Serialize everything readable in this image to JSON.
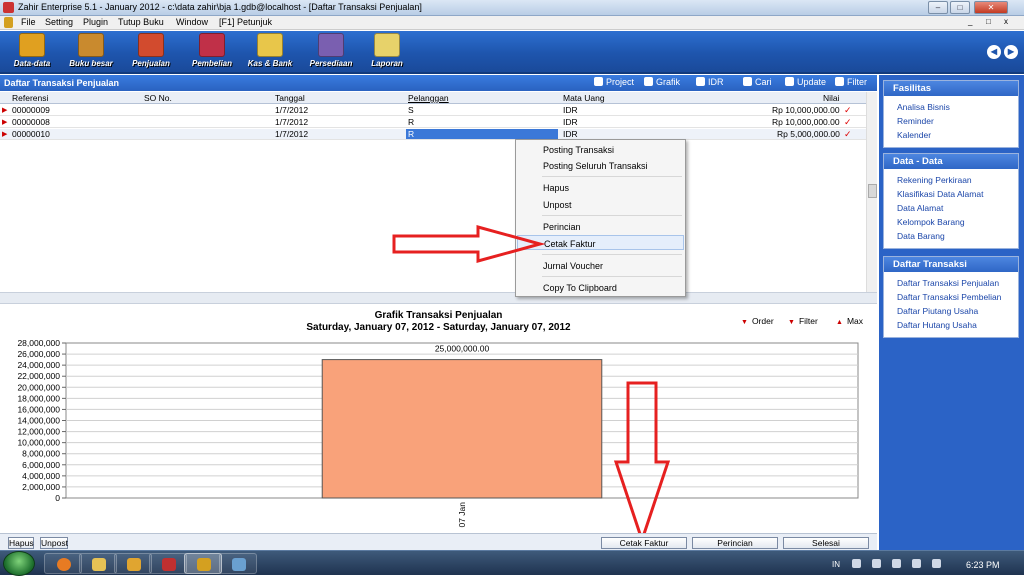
{
  "window": {
    "title": "Zahir Enterprise 5.1 - January 2012 - c:\\data zahir\\bja 1.gdb@localhost - [Daftar Transaksi Penjualan]",
    "controls": [
      "–",
      "□",
      "✕"
    ],
    "child_controls": [
      "_",
      "□",
      "x"
    ]
  },
  "menu": [
    "File",
    "Setting",
    "Plugin",
    "Tutup Buku",
    "Window",
    "[F1] Petunjuk"
  ],
  "toolbar": [
    {
      "label": "Data-data",
      "color": "#e0a020"
    },
    {
      "label": "Buku besar",
      "color": "#c98a2e"
    },
    {
      "label": "Penjualan",
      "color": "#d24b2e"
    },
    {
      "label": "Pembelian",
      "color": "#c03048"
    },
    {
      "label": "Kas & Bank",
      "color": "#e8c64a"
    },
    {
      "label": "Persediaan",
      "color": "#7a5fb0"
    },
    {
      "label": "Laporan",
      "color": "#e7d26a"
    }
  ],
  "nav": {
    "back": "◀",
    "forward": "▶"
  },
  "panel": {
    "title": "Daftar Transaksi Penjualan",
    "actions": [
      {
        "label": "Project",
        "icon": "project-icon"
      },
      {
        "label": "Grafik",
        "icon": "chart-icon"
      },
      {
        "label": "IDR",
        "icon": "currency-icon"
      },
      {
        "label": "Cari",
        "icon": "search-icon"
      },
      {
        "label": "Update",
        "icon": "refresh-icon"
      },
      {
        "label": "Filter",
        "icon": "filter-icon"
      }
    ]
  },
  "grid": {
    "columns": [
      "Referensi",
      "SO No.",
      "Tanggal",
      "Pelanggan",
      "Mata Uang",
      "Nilai"
    ],
    "rows": [
      {
        "ref": "00000009",
        "so": "",
        "date": "1/7/2012",
        "customer": "S",
        "currency": "IDR",
        "value": "Rp 10,000,000.00"
      },
      {
        "ref": "00000008",
        "so": "",
        "date": "1/7/2012",
        "customer": "R",
        "currency": "IDR",
        "value": "Rp 10,000,000.00"
      },
      {
        "ref": "00000010",
        "so": "",
        "date": "1/7/2012",
        "customer": "R",
        "currency": "IDR",
        "value": "Rp 5,000,000.00"
      }
    ],
    "check": "✓",
    "indicator": "▶"
  },
  "context_menu": {
    "items": [
      "Posting Transaksi",
      "Posting Seluruh Transaksi",
      "Hapus",
      "Unpost",
      "Perincian",
      "Cetak Faktur",
      "Jurnal Voucher",
      "Copy To Clipboard"
    ],
    "highlighted": "Cetak Faktur"
  },
  "chart_controls": [
    {
      "label": "Order",
      "glyph": "▼"
    },
    {
      "label": "Filter",
      "glyph": "▼"
    },
    {
      "label": "Max",
      "glyph": "▲"
    }
  ],
  "chart_data": {
    "type": "bar",
    "title": "Grafik Transaksi Penjualan",
    "subtitle": "Saturday, January 07, 2012 - Saturday, January 07, 2012",
    "categories": [
      "07 Jan"
    ],
    "values": [
      25000000
    ],
    "data_labels": [
      "25,000,000.00"
    ],
    "ylim": [
      0,
      28000000
    ],
    "yticks": [
      "0",
      "2,000,000",
      "4,000,000",
      "6,000,000",
      "8,000,000",
      "10,000,000",
      "12,000,000",
      "14,000,000",
      "16,000,000",
      "18,000,000",
      "20,000,000",
      "22,000,000",
      "24,000,000",
      "26,000,000",
      "28,000,000"
    ],
    "grid": true,
    "bar_color": "#f9a27a"
  },
  "bottom": {
    "left_buttons": [
      "Hapus",
      "Unpost"
    ],
    "right_buttons": [
      "Cetak Faktur",
      "Perincian",
      "Selesai"
    ]
  },
  "sidebar": [
    {
      "title": "Fasilitas",
      "items": [
        "Analisa Bisnis",
        "Reminder",
        "Kalender"
      ]
    },
    {
      "title": "Data - Data",
      "items": [
        "Rekening Perkiraan",
        "Klasifikasi Data Alamat",
        "Data Alamat",
        "Kelompok Barang",
        "Data Barang"
      ]
    },
    {
      "title": "Daftar Transaksi",
      "items": [
        "Daftar Transaksi Penjualan",
        "Daftar Transaksi Pembelian",
        "Daftar Piutang Usaha",
        "Daftar Hutang Usaha"
      ]
    }
  ],
  "taskbar": {
    "apps": [
      {
        "name": "firefox",
        "color": "#e77b23"
      },
      {
        "name": "explorer",
        "color": "#e6c255"
      },
      {
        "name": "media",
        "color": "#e0a530"
      },
      {
        "name": "other",
        "color": "#c03030"
      },
      {
        "name": "zahir",
        "color": "#d4a020"
      },
      {
        "name": "extra",
        "color": "#6aa0d0"
      }
    ],
    "lang": "IN",
    "clock": "6:23 PM"
  }
}
